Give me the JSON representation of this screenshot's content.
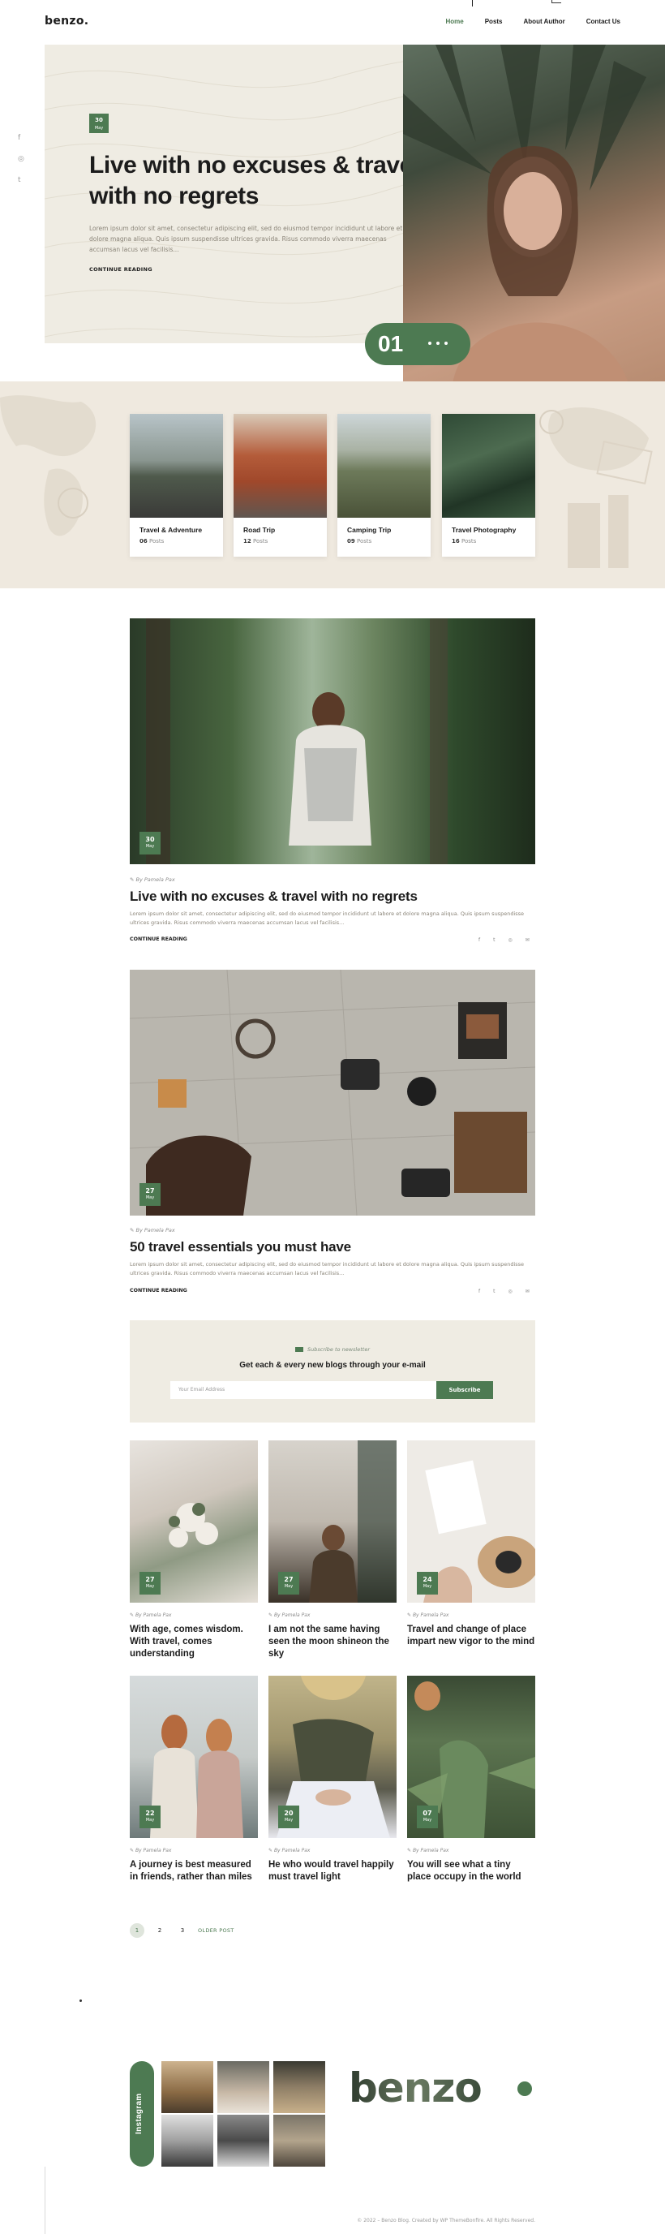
{
  "header": {
    "logo": "benzo.",
    "nav": [
      "Home",
      "Posts",
      "About Author",
      "Contact Us"
    ]
  },
  "social": {
    "items": [
      "f",
      "◎",
      "t"
    ]
  },
  "hero": {
    "date_day": "30",
    "date_month": "May",
    "title": "Live with no excuses & travel with no regrets",
    "excerpt": "Lorem ipsum dolor sit amet, consectetur adipiscing elit, sed do eiusmod tempor incididunt ut labore et dolore magna aliqua. Quis ipsum suspendisse ultrices gravida. Risus commodo viverra maecenas accumsan lacus vel facilisis...",
    "continue": "CONTINUE READING",
    "slide_number": "01"
  },
  "categories": [
    {
      "name": "Travel & Adventure",
      "count": "06",
      "unit": "Posts"
    },
    {
      "name": "Road Trip",
      "count": "12",
      "unit": "Posts"
    },
    {
      "name": "Camping Trip",
      "count": "09",
      "unit": "Posts"
    },
    {
      "name": "Travel Photography",
      "count": "16",
      "unit": "Posts"
    }
  ],
  "posts": [
    {
      "day": "30",
      "month": "May",
      "author": "By Pamela Pax",
      "title": "Live with no excuses & travel with no regrets",
      "excerpt": "Lorem ipsum dolor sit amet, consectetur adipiscing elit, sed do eiusmod tempor incididunt ut labore et dolore magna aliqua. Quis ipsum suspendisse ultrices gravida. Risus commodo viverra maecenas accumsan lacus vel facilisis...",
      "continue": "CONTINUE READING"
    },
    {
      "day": "27",
      "month": "May",
      "author": "By Pamela Pax",
      "title": "50 travel essentials you must have",
      "excerpt": "Lorem ipsum dolor sit amet, consectetur adipiscing elit, sed do eiusmod tempor incididunt ut labore et dolore magna aliqua. Quis ipsum suspendisse ultrices gravida. Risus commodo viverra maecenas accumsan lacus vel facilisis...",
      "continue": "CONTINUE READING"
    }
  ],
  "share_icons": [
    "f",
    "t",
    "◎",
    "✉"
  ],
  "newsletter": {
    "label": "Subscribe to newsletter",
    "title": "Get each & every new blogs through your e-mail",
    "placeholder": "Your Email Address",
    "button": "Subscribe"
  },
  "grid_posts": [
    {
      "day": "27",
      "month": "May",
      "author": "By Pamela Pax",
      "title": "With age, comes wisdom. With travel, comes understanding"
    },
    {
      "day": "27",
      "month": "May",
      "author": "By Pamela Pax",
      "title": "I am not the same having seen the moon shineon the sky"
    },
    {
      "day": "24",
      "month": "May",
      "author": "By Pamela Pax",
      "title": "Travel and change of place impart new vigor to the mind"
    },
    {
      "day": "22",
      "month": "May",
      "author": "By Pamela Pax",
      "title": "A journey is best measured in friends, rather than miles"
    },
    {
      "day": "20",
      "month": "May",
      "author": "By Pamela Pax",
      "title": "He who would travel happily must travel light"
    },
    {
      "day": "07",
      "month": "May",
      "author": "By Pamela Pax",
      "title": "You will see what a tiny place occupy in the world"
    }
  ],
  "pagination": {
    "pages": [
      "1",
      "2",
      "3"
    ],
    "older": "OLDER POST"
  },
  "footer": {
    "instagram": "Instagram",
    "logo": "benzo",
    "copyright": "© 2022 – Benzo Blog. Created by WP ThemeBonfire. All Rights Reserved."
  },
  "colors": {
    "accent": "#4d7a52",
    "hero_bg": "#efece3",
    "band_bg": "#efe9df"
  }
}
